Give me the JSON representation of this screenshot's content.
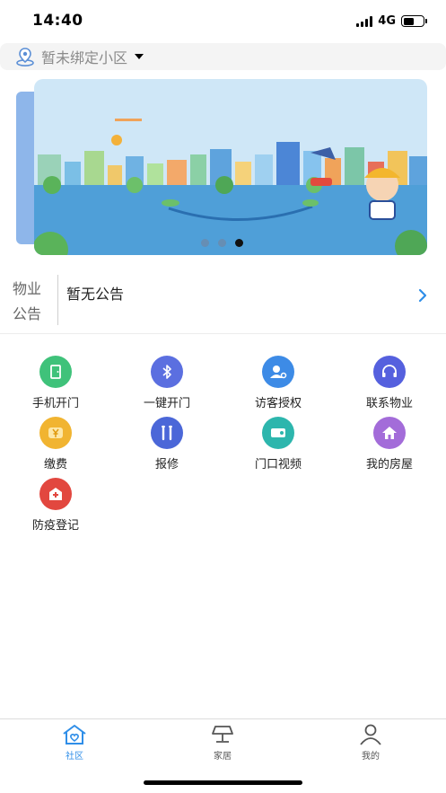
{
  "status_bar": {
    "time": "14:40",
    "network": "4G"
  },
  "location": {
    "text": "暂未绑定小区"
  },
  "banner": {
    "slide_count": 3,
    "active_index": 2
  },
  "notice": {
    "label": "物业公告",
    "text": "暂无公告"
  },
  "grid": {
    "items": [
      {
        "label": "手机开门",
        "icon": "door-icon",
        "color": "#3fc27a"
      },
      {
        "label": "一键开门",
        "icon": "bluetooth-icon",
        "color": "#5b6fe0"
      },
      {
        "label": "访客授权",
        "icon": "visitor-key-icon",
        "color": "#3d8be6"
      },
      {
        "label": "联系物业",
        "icon": "headset-icon",
        "color": "#5560de"
      },
      {
        "label": "缴费",
        "icon": "yen-coin-icon",
        "color": "#f1b431"
      },
      {
        "label": "报修",
        "icon": "repair-tools-icon",
        "color": "#4b67d8"
      },
      {
        "label": "门口视频",
        "icon": "video-camera-icon",
        "color": "#2db6ad"
      },
      {
        "label": "我的房屋",
        "icon": "house-icon",
        "color": "#a36cd9"
      },
      {
        "label": "防疫登记",
        "icon": "hospital-icon",
        "color": "#e2473f"
      }
    ]
  },
  "tabbar": {
    "tabs": [
      {
        "label": "社区",
        "icon": "community-home-icon",
        "active": true
      },
      {
        "label": "家居",
        "icon": "lamp-icon",
        "active": false
      },
      {
        "label": "我的",
        "icon": "user-icon",
        "active": false
      }
    ]
  },
  "colors": {
    "accent": "#2f8ee8",
    "notice_arrow": "#2f8ee8"
  }
}
